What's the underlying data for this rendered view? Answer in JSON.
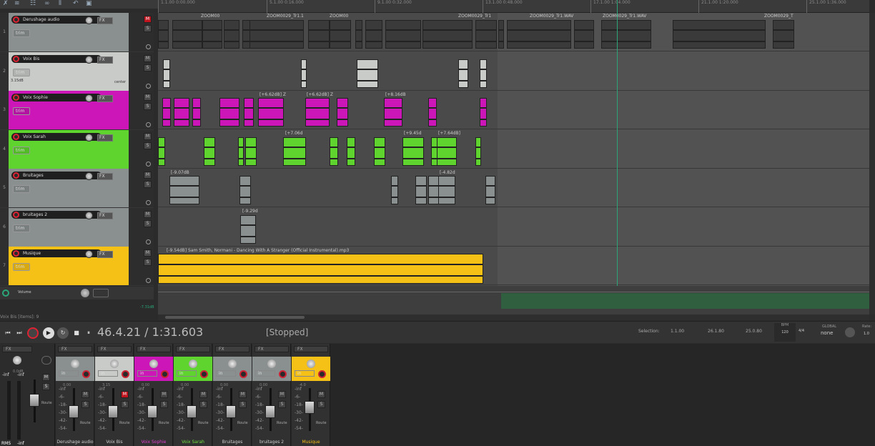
{
  "ruler": [
    "1.1.00\n0:00.000",
    "5.1.00\n0:16.000",
    "9.1.00\n0:32.000",
    "13.1.00\n0:48.000",
    "17.1.00\n1:04.000",
    "21.1.00\n1:20.000",
    "25.1.00\n1:36.000"
  ],
  "tracks": [
    {
      "num": "1",
      "name": "Derushage audio",
      "color": "#8a9090",
      "lane": "#4a4a4a"
    },
    {
      "num": "2",
      "name": "Voix Bis",
      "color": "#c9cbc9",
      "lane": "#4a4a4a",
      "vol": "3.15dB",
      "pan": "center"
    },
    {
      "num": "3",
      "name": "Voix Sophie",
      "color": "#cc16b8",
      "lane": "#4a4a4a"
    },
    {
      "num": "4",
      "name": "Voix Sarah",
      "color": "#5fd42e",
      "lane": "#4a4a4a"
    },
    {
      "num": "5",
      "name": "Bruitages",
      "color": "#8a9090",
      "lane": "#4a4a4a"
    },
    {
      "num": "6",
      "name": "bruitages 2",
      "color": "#8a9090",
      "lane": "#4a4a4a"
    },
    {
      "num": "7",
      "name": "Musique",
      "color": "#f5c116",
      "lane": "#4a4a4a"
    }
  ],
  "labels": {
    "trim": "trim",
    "fx": "FX",
    "mute": "M",
    "solo": "S",
    "master": "Volume",
    "master_db": "-7.31dB",
    "in": "in",
    "route": "Route"
  },
  "item_labels": {
    "zoom1": "ZOOM00",
    "zoom2": "ZOOM0029_Tr1.1",
    "zoom3": "ZOOM00",
    "zoom4": "ZOOM0029_Tr1",
    "zoom5": "ZOOM0029_Tr1.WAV",
    "zoom6": "ZOOM0029_Tr1.WAV",
    "zoom7": "ZOOM0029_T",
    "s1": "[+6.62dB] Z",
    "s2": "[+6.62dB] Z",
    "s3": "[+8.16dB",
    "v1": "[+7.06d",
    "v2": "[+9.45d",
    "v3": "[+7.64dB]",
    "b1": "[-9.07dB",
    "b2": "[-4.82d",
    "b3": "[-9.29d",
    "music": "[-9.54dB] Sam Smith, Normani - Dancing With A Stranger (Official Instrumental).mp3"
  },
  "transport": {
    "position": "46.4.21 / 1:31.603",
    "status": "[Stopped]",
    "selection_label": "Selection:",
    "sel_start": "1.1.00",
    "sel_end": "26.1.80",
    "sel_len": "25.0.80",
    "bpm_label": "BPM",
    "bpm": "120",
    "ts": "4/4",
    "global": "GLOBAL",
    "none": "none",
    "rate_label": "Rate:",
    "rate": "1.0"
  },
  "footer_status": "Voix Bis [items]: 9",
  "mixer": [
    {
      "name": "Derushage audio",
      "color": "#8a9090",
      "vol": "0.00"
    },
    {
      "name": "Voix Bis",
      "color": "#c9cbc9",
      "vol": "3.15"
    },
    {
      "name": "Voix Sophie",
      "color": "#cc16b8",
      "vol": "0.00"
    },
    {
      "name": "Voix Sarah",
      "color": "#5fd42e",
      "vol": "0.00"
    },
    {
      "name": "Bruitages",
      "color": "#8a9090",
      "vol": "0.00"
    },
    {
      "name": "bruitages 2",
      "color": "#8a9090",
      "vol": "0.00"
    },
    {
      "name": "Musique",
      "color": "#f5c116",
      "vol": "-4.0"
    }
  ],
  "master_meter": {
    "left": "-inf",
    "right": "-inf",
    "rms": "RMS",
    "val": "-inf",
    "db": "0.0dB"
  },
  "meter_scale": [
    "-inf",
    "-6-",
    "-18-",
    "-30-",
    "-42-",
    "-54-"
  ]
}
